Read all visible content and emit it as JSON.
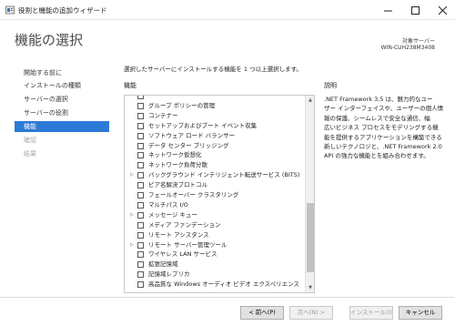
{
  "window": {
    "title": "役割と機能の追加ウィザード",
    "minimize_icon": "minimize-icon",
    "maximize_icon": "maximize-icon",
    "close_icon": "close-icon"
  },
  "header": {
    "page_title": "機能の選択",
    "target_label": "対象サーバー",
    "target_name": "WIN-CUH238M3408"
  },
  "nav": {
    "items": [
      {
        "label": "開始する前に",
        "state": "normal"
      },
      {
        "label": "インストールの種類",
        "state": "normal"
      },
      {
        "label": "サーバーの選択",
        "state": "normal"
      },
      {
        "label": "サーバーの役割",
        "state": "normal"
      },
      {
        "label": "機能",
        "state": "active"
      },
      {
        "label": "確認",
        "state": "disabled"
      },
      {
        "label": "結果",
        "state": "disabled"
      }
    ]
  },
  "main": {
    "instruction": "選択したサーバーにインストールする機能を 1 つ以上選択します。",
    "features_heading": "機能",
    "description_heading": "説明",
    "features": [
      {
        "label": "",
        "expandable": false,
        "checked": false
      },
      {
        "label": "グループ ポリシーの管理",
        "expandable": false,
        "checked": false
      },
      {
        "label": "コンテナー",
        "expandable": false,
        "checked": false
      },
      {
        "label": "セットアップおよびブート イベント収集",
        "expandable": false,
        "checked": false
      },
      {
        "label": "ソフトウェア ロード バランサー",
        "expandable": false,
        "checked": false
      },
      {
        "label": "データ センター ブリッジング",
        "expandable": false,
        "checked": false
      },
      {
        "label": "ネットワーク仮想化",
        "expandable": false,
        "checked": false
      },
      {
        "label": "ネットワーク負荷分散",
        "expandable": false,
        "checked": false
      },
      {
        "label": "バックグラウンド インテリジェント転送サービス (BITS)",
        "expandable": true,
        "checked": false
      },
      {
        "label": "ピア名解決プロトコル",
        "expandable": false,
        "checked": false
      },
      {
        "label": "フェールオーバー クラスタリング",
        "expandable": false,
        "checked": false
      },
      {
        "label": "マルチパス I/O",
        "expandable": false,
        "checked": false
      },
      {
        "label": "メッセージ キュー",
        "expandable": true,
        "checked": false
      },
      {
        "label": "メディア ファンデーション",
        "expandable": false,
        "checked": false
      },
      {
        "label": "リモート アシスタンス",
        "expandable": false,
        "checked": false
      },
      {
        "label": "リモート サーバー管理ツール",
        "expandable": true,
        "checked": false
      },
      {
        "label": "ワイヤレス LAN サービス",
        "expandable": false,
        "checked": false
      },
      {
        "label": "拡張記憶域",
        "expandable": false,
        "checked": false
      },
      {
        "label": "記憶域レプリカ",
        "expandable": false,
        "checked": false
      },
      {
        "label": "高品質な Windows オーディオ ビデオ エクスペリエンス",
        "expandable": false,
        "checked": false
      }
    ],
    "description_lines": [
      ".NET Framework 3.5 は、魅力的なユー",
      "ザー インターフェイスや、ユーザーの個人情",
      "報の保護、シームレスで安全な通信、幅",
      "広いビジネス プロセスをモデリングする機",
      "能を提供するアプリケーションを構築できる",
      "新しいテクノロジと、.NET Framework 2.0",
      "API の強力な機能とを組み合わせます。"
    ]
  },
  "footer": {
    "prev_label": "< 前へ(P)",
    "next_label": "次へ(N) >",
    "install_label": "インストール(I)",
    "cancel_label": "キャンセル"
  },
  "colors": {
    "accent": "#2c7ad6",
    "disabled_text": "#a8a8a8"
  }
}
